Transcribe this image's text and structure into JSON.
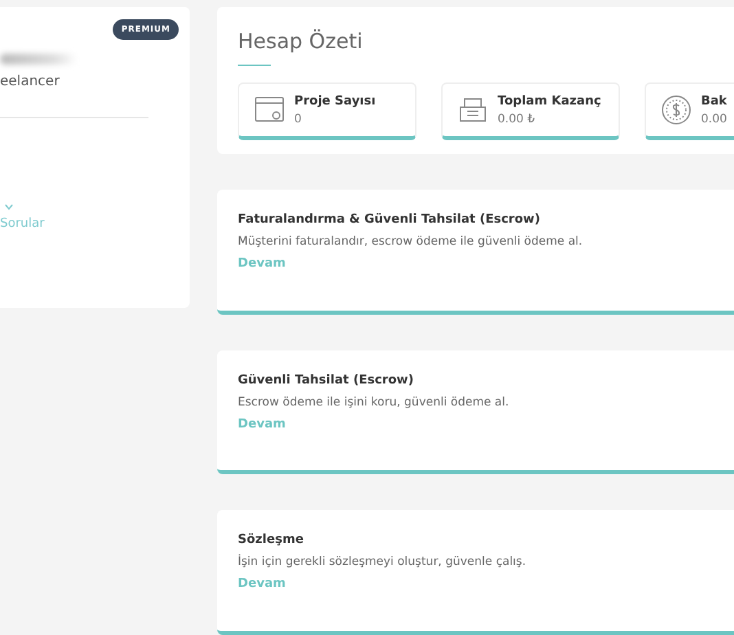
{
  "profile": {
    "badge": "PREMIUM",
    "role": "eelancer",
    "menu_links": [
      {
        "kind": "dropdown"
      },
      {
        "kind": "text",
        "label": "Sorular"
      }
    ]
  },
  "summary": {
    "title": "Hesap Özeti",
    "stats": [
      {
        "kind": "browser",
        "label": "Proje Sayısı",
        "value": "0"
      },
      {
        "kind": "register",
        "label": "Toplam Kazanç",
        "value": "0.00 ₺"
      },
      {
        "kind": "coin",
        "label": "Bak",
        "value": "0.00"
      }
    ]
  },
  "features": [
    {
      "title": "Faturalandırma & Güvenli Tahsilat (Escrow)",
      "description": "Müşterini faturalandır, escrow ödeme ile güvenli ödeme al.",
      "link": "Devam"
    },
    {
      "title": "Güvenli Tahsilat (Escrow)",
      "description": "Escrow ödeme ile işini koru, güvenli ödeme al.",
      "link": "Devam"
    },
    {
      "title": "Sözleşme",
      "description": "İşin için gerekli sözleşmeyi oluştur, güvenle çalış.",
      "link": "Devam"
    }
  ]
}
